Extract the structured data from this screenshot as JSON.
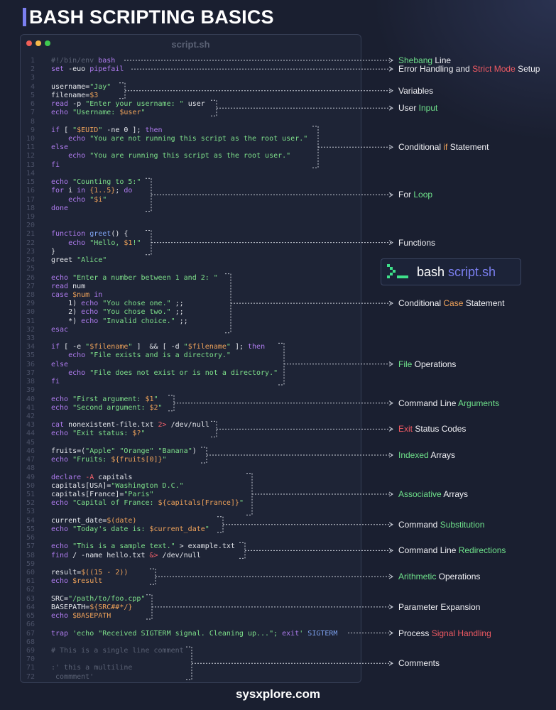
{
  "header": {
    "title": "BASH SCRIPTING BASICS"
  },
  "window": {
    "title": "script.sh",
    "dots": [
      "#f05f57",
      "#f5b94a",
      "#3fc950"
    ]
  },
  "colors": {
    "keyword": "#b07cf0",
    "string": "#7ee08a",
    "variable": "#f0a35a",
    "red": "#f0606a",
    "comment": "#5b6275",
    "blue": "#7ea2f0",
    "accent": "#7b7ff0"
  },
  "code": [
    [
      [
        "c:#!/bin/env ",
        "k:bash"
      ]
    ],
    [
      [
        "k:set",
        " -euo ",
        "k:pipefail"
      ]
    ],
    [
      [
        ""
      ]
    ],
    [
      [
        "username=",
        "s:\"Jay\""
      ]
    ],
    [
      [
        "filename=",
        "v:$3"
      ]
    ],
    [
      [
        "k:read",
        " -p ",
        "s:\"Enter your username: \"",
        " user"
      ]
    ],
    [
      [
        "k:echo",
        " ",
        "s:\"Username: ",
        "v:$user",
        "s:\""
      ]
    ],
    [
      [
        ""
      ]
    ],
    [
      [
        "k:if",
        " [ ",
        "s:\"",
        "v:$EUID",
        "s:\"",
        " -ne 0 ]; ",
        "k:then"
      ]
    ],
    [
      [
        "    ",
        "k:echo",
        " ",
        "s:\"You are not running this script as the root user.\""
      ]
    ],
    [
      [
        "k:else"
      ]
    ],
    [
      [
        "    ",
        "k:echo",
        " ",
        "s:\"You are running this script as the root user.\""
      ]
    ],
    [
      [
        "k:fi"
      ]
    ],
    [
      [
        ""
      ]
    ],
    [
      [
        "k:echo",
        " ",
        "s:\"Counting to 5:\""
      ]
    ],
    [
      [
        "k:for",
        " i ",
        "k:in",
        " ",
        "v:{1..5}",
        "; ",
        "k:do"
      ]
    ],
    [
      [
        "    ",
        "k:echo",
        " ",
        "s:\"",
        "v:$i",
        "s:\""
      ]
    ],
    [
      [
        "k:done"
      ]
    ],
    [
      [
        ""
      ]
    ],
    [
      [
        ""
      ]
    ],
    [
      [
        "k:function",
        " ",
        "b:greet",
        "() {"
      ]
    ],
    [
      [
        "    ",
        "k:echo",
        " ",
        "s:\"Hello, ",
        "v:$1",
        "s:!\""
      ]
    ],
    [
      [
        "}"
      ]
    ],
    [
      [
        "greet ",
        "s:\"Alice\""
      ]
    ],
    [
      [
        ""
      ]
    ],
    [
      [
        "k:echo",
        " ",
        "s:\"Enter a number between 1 and 2: \""
      ]
    ],
    [
      [
        "k:read",
        " num"
      ]
    ],
    [
      [
        "k:case",
        " ",
        "v:$num",
        " ",
        "k:in"
      ]
    ],
    [
      [
        "    1) ",
        "k:echo",
        " ",
        "s:\"You chose one.\"",
        " ;;"
      ]
    ],
    [
      [
        "    2) ",
        "k:echo",
        " ",
        "s:\"You chose two.\"",
        " ;;"
      ]
    ],
    [
      [
        "    *) ",
        "k:echo",
        " ",
        "s:\"Invalid choice.\"",
        " ;;"
      ]
    ],
    [
      [
        "k:esac"
      ]
    ],
    [
      [
        ""
      ]
    ],
    [
      [
        "k:if",
        " [ -e ",
        "s:\"",
        "v:$filename",
        "s:\"",
        " ]  && [ -d ",
        "s:\"",
        "v:$filename",
        "s:\"",
        " ]; ",
        "k:then"
      ]
    ],
    [
      [
        "    ",
        "k:echo",
        " ",
        "s:\"File exists and is a directory.\""
      ]
    ],
    [
      [
        "k:else"
      ]
    ],
    [
      [
        "    ",
        "k:echo",
        " ",
        "s:\"File does not exist or is not a directory.\""
      ]
    ],
    [
      [
        "k:fi"
      ]
    ],
    [
      [
        ""
      ]
    ],
    [
      [
        "k:echo",
        " ",
        "s:\"First argument: ",
        "v:$1",
        "s:\""
      ]
    ],
    [
      [
        "k:echo",
        " ",
        "s:\"Second argument: ",
        "v:$2",
        "s:\""
      ]
    ],
    [
      [
        ""
      ]
    ],
    [
      [
        "k:cat",
        " nonexistent-file.txt ",
        "r:2>",
        " /dev/null"
      ]
    ],
    [
      [
        "k:echo",
        " ",
        "s:\"Exit status: ",
        "v:$?",
        "s:\""
      ]
    ],
    [
      [
        ""
      ]
    ],
    [
      [
        "fruits=(",
        "s:\"Apple\"",
        " ",
        "s:\"Orange\"",
        " ",
        "s:\"Banana\"",
        ")"
      ]
    ],
    [
      [
        "k:echo",
        " ",
        "s:\"Fruits: ",
        "v:${fruits[0]}",
        "s:\""
      ]
    ],
    [
      [
        ""
      ]
    ],
    [
      [
        "k:declare",
        " ",
        "r:-A",
        " capitals"
      ]
    ],
    [
      [
        "capitals[USA]=",
        "s:\"Washington D.C.\""
      ]
    ],
    [
      [
        "capitals[France]=",
        "s:\"Paris\""
      ]
    ],
    [
      [
        "k:echo",
        " ",
        "s:\"Capital of France: ",
        "v:${capitals[France]}",
        "s:\""
      ]
    ],
    [
      [
        ""
      ]
    ],
    [
      [
        "current_date=",
        "v:$(date)"
      ]
    ],
    [
      [
        "k:echo",
        " ",
        "s:\"Today's date is: ",
        "v:$current_date",
        "s:\""
      ]
    ],
    [
      [
        ""
      ]
    ],
    [
      [
        "k:echo",
        " ",
        "s:\"This is a sample text.\"",
        " > example.txt"
      ]
    ],
    [
      [
        "k:find",
        " / -name hello.txt ",
        "r:&>",
        " /dev/null"
      ]
    ],
    [
      [
        ""
      ]
    ],
    [
      [
        "result=",
        "v:$((15 - 2))"
      ]
    ],
    [
      [
        "k:echo",
        " ",
        "v:$result"
      ]
    ],
    [
      [
        ""
      ]
    ],
    [
      [
        "SRC=",
        "s:\"/path/to/foo.cpp\""
      ]
    ],
    [
      [
        "BASEPATH=",
        "v:${SRC##*/}"
      ]
    ],
    [
      [
        "k:echo",
        " ",
        "v:$BASEPATH"
      ]
    ],
    [
      [
        ""
      ]
    ],
    [
      [
        "k:trap",
        " ",
        "s:'echo \"Received SIGTERM signal. Cleaning up...\"; ",
        "k:exit",
        "s:'",
        " ",
        "b:SIGTERM"
      ]
    ],
    [
      [
        ""
      ]
    ],
    [
      [
        "c:# This is a single line comment"
      ]
    ],
    [
      [
        ""
      ]
    ],
    [
      [
        "c::' this a multiline"
      ]
    ],
    [
      [
        "c: commment'"
      ]
    ]
  ],
  "labels": [
    {
      "parts": [
        [
          "g",
          "Shebang"
        ],
        [
          "w",
          " Line"
        ]
      ],
      "line": 1
    },
    {
      "parts": [
        [
          "w",
          "Error Handling and "
        ],
        [
          "rr",
          "Strict Mode"
        ],
        [
          "w",
          " Setup"
        ]
      ],
      "line": 2
    },
    {
      "parts": [
        [
          "w",
          "Variables"
        ]
      ],
      "line": 4.5
    },
    {
      "parts": [
        [
          "w",
          "User "
        ],
        [
          "g",
          "Input"
        ]
      ],
      "line": 6.5
    },
    {
      "parts": [
        [
          "w",
          "Conditional "
        ],
        [
          "o",
          "if"
        ],
        [
          "w",
          " Statement"
        ]
      ],
      "line": 11
    },
    {
      "parts": [
        [
          "w",
          "For "
        ],
        [
          "g",
          "Loop"
        ]
      ],
      "line": 16.5
    },
    {
      "parts": [
        [
          "w",
          "Functions"
        ]
      ],
      "line": 22
    },
    {
      "parts": [
        [
          "w",
          "Conditional "
        ],
        [
          "o",
          "Case"
        ],
        [
          "w",
          " Statement"
        ]
      ],
      "line": 29
    },
    {
      "parts": [
        [
          "g",
          "File"
        ],
        [
          "w",
          " Operations"
        ]
      ],
      "line": 36
    },
    {
      "parts": [
        [
          "w",
          "Command Line "
        ],
        [
          "g",
          "Arguments"
        ]
      ],
      "line": 40.5
    },
    {
      "parts": [
        [
          "rr",
          "Exit"
        ],
        [
          "w",
          " Status Codes"
        ]
      ],
      "line": 43.5
    },
    {
      "parts": [
        [
          "g",
          "Indexed"
        ],
        [
          "w",
          " Arrays"
        ]
      ],
      "line": 46.5
    },
    {
      "parts": [
        [
          "g",
          "Associative"
        ],
        [
          "w",
          " Arrays"
        ]
      ],
      "line": 51
    },
    {
      "parts": [
        [
          "w",
          "Command "
        ],
        [
          "g",
          "Substitution"
        ]
      ],
      "line": 54.5
    },
    {
      "parts": [
        [
          "w",
          "Command Line "
        ],
        [
          "g",
          "Redirections"
        ]
      ],
      "line": 57.5
    },
    {
      "parts": [
        [
          "g",
          "Arithmetic"
        ],
        [
          "w",
          " Operations"
        ]
      ],
      "line": 60.5
    },
    {
      "parts": [
        [
          "w",
          "Parameter Expansion"
        ]
      ],
      "line": 64
    },
    {
      "parts": [
        [
          "w",
          "Process "
        ],
        [
          "rr",
          "Signal Handling"
        ]
      ],
      "line": 67
    },
    {
      "parts": [
        [
          "w",
          "Comments"
        ]
      ],
      "line": 70.5
    }
  ],
  "badge": {
    "prefix": "bash",
    "suffix": "script.sh"
  },
  "footer": {
    "text": "sysxplore.com"
  }
}
